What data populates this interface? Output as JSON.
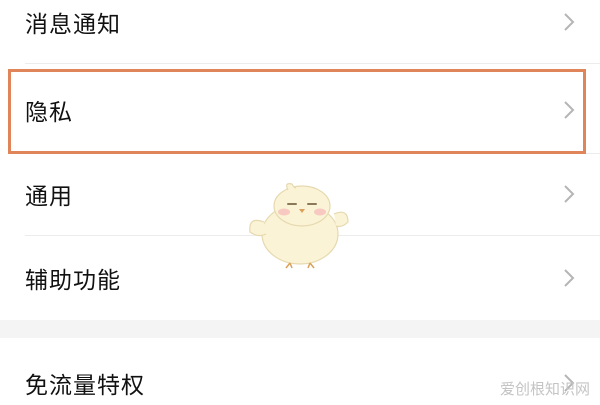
{
  "settings": {
    "items": [
      {
        "label": "消息通知"
      },
      {
        "label": "隐私"
      },
      {
        "label": "通用"
      },
      {
        "label": "辅助功能"
      },
      {
        "label": "免流量特权"
      }
    ]
  },
  "highlight": {
    "target": "隐私",
    "color": "#e0855a"
  },
  "watermark": {
    "text": "爱创根知识网"
  },
  "icons": {
    "chevron": "chevron-right-icon",
    "mascot": "chick-mascot-icon"
  }
}
